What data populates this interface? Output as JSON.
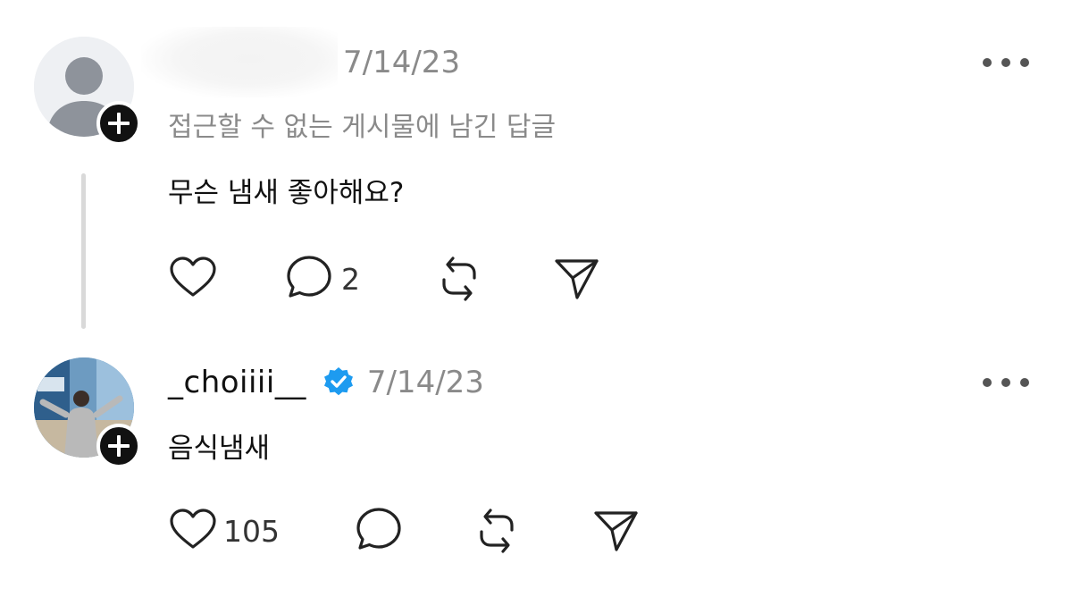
{
  "posts": [
    {
      "username_text": "",
      "date": "7/14/23",
      "subtitle": "접근할 수 없는 게시물에 남긴 답글",
      "body": "무슨 냄새 좋아해요?",
      "like_count": "",
      "reply_count": "2",
      "avatar_icon": "default-user-icon"
    },
    {
      "username": "_choiiii__",
      "verified": true,
      "date": "7/14/23",
      "body": "음식냄새",
      "like_count": "105",
      "reply_count": "",
      "avatar_icon": "profile-photo"
    }
  ],
  "icons": {
    "like": "heart-icon",
    "reply": "comment-icon",
    "repost": "repost-icon",
    "share": "send-icon",
    "more": "more-icon",
    "follow": "plus-icon",
    "verified": "verified-badge-icon"
  },
  "colors": {
    "verified": "#1d9bf0",
    "secondary_text": "#8a8a8a",
    "thread_line": "#d9d9d9"
  }
}
